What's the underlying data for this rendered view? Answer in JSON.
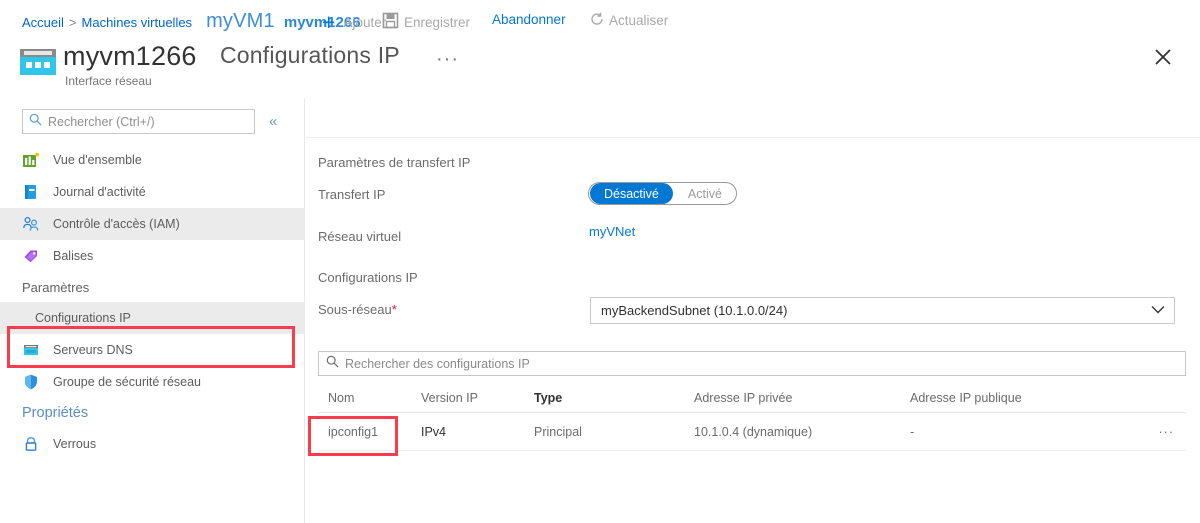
{
  "breadcrumb": {
    "items": [
      {
        "label": "Accueil",
        "type": "link"
      },
      {
        "label": ">",
        "type": "sep"
      },
      {
        "label": "Machines virtuelles",
        "type": "link"
      }
    ],
    "overlay_large": "myVM1",
    "overlay_small": "myvm1266"
  },
  "header": {
    "resource_name": "myvm1266",
    "resource_type": "Interface réseau",
    "blade_title": "Configurations IP",
    "more_menu": "···",
    "close_label": "Fermer"
  },
  "sidebar": {
    "search_placeholder": "Rechercher (Ctrl+/)",
    "search_value": "",
    "collapse_label": "«",
    "items": [
      {
        "label": "Vue d'ensemble",
        "icon": "chart-icon",
        "selected": false
      },
      {
        "label": "Journal d'activité",
        "icon": "book-icon",
        "selected": false
      },
      {
        "label": "Contrôle d'accès (IAM)",
        "icon": "people-icon",
        "selected": true
      },
      {
        "label": "Balises",
        "icon": "tag-icon",
        "selected": false
      }
    ],
    "group_settings": "Paramètres",
    "settings_items": [
      {
        "label": "Configurations IP",
        "icon": "none",
        "selected": true,
        "highlighted": true
      },
      {
        "label": "Serveurs DNS",
        "icon": "dns-icon",
        "selected": false
      },
      {
        "label": "Groupe de sécurité réseau",
        "icon": "shield-icon",
        "selected": false
      }
    ],
    "group_properties": "Propriétés",
    "properties_items": [
      {
        "label": "Verrous",
        "icon": "lock-icon",
        "selected": false
      }
    ]
  },
  "toolbar": {
    "add_label": "Ajouter",
    "save_label": "Enregistrer",
    "discard_label": "Abandonner",
    "refresh_label": "Actualiser"
  },
  "content": {
    "forwarding_section": "Paramètres de transfert IP",
    "forwarding_label": "Transfert IP",
    "toggle_off": "Désactivé",
    "toggle_on": "Activé",
    "toggle_selected": "Désactivé",
    "vnet_label": "Réseau virtuel",
    "vnet_value": "myVNet",
    "ipconfig_section": "Configurations IP",
    "subnet_label": "Sous-réseau",
    "subnet_required": "*",
    "subnet_value": "myBackendSubnet (10.1.0.0/24)",
    "filter_placeholder": "Rechercher des configurations IP",
    "filter_value": ""
  },
  "table": {
    "columns": [
      {
        "label": "Nom",
        "bold": false
      },
      {
        "label": "Version IP",
        "bold": false
      },
      {
        "label": "Type",
        "bold": true
      },
      {
        "label": "Adresse IP privée",
        "bold": false
      },
      {
        "label": "Adresse IP publique",
        "bold": false
      }
    ],
    "rows": [
      {
        "name": "ipconfig1",
        "ip_version": "IPv4",
        "type": "Principal",
        "private_ip": "10.1.0.4 (dynamique)",
        "public_ip": "-",
        "menu": "···"
      }
    ]
  },
  "annotations": {
    "accent_color": "#fa3c4c",
    "boxes": [
      {
        "target": "sidebar-item-ip-configurations"
      },
      {
        "target": "table-cell-ipconfig1"
      }
    ]
  },
  "colors": {
    "azure_blue": "#0078d4",
    "link_blue": "#0066cc",
    "selected_bg": "#ebebeb",
    "annotation_red": "#fa3c4c"
  }
}
